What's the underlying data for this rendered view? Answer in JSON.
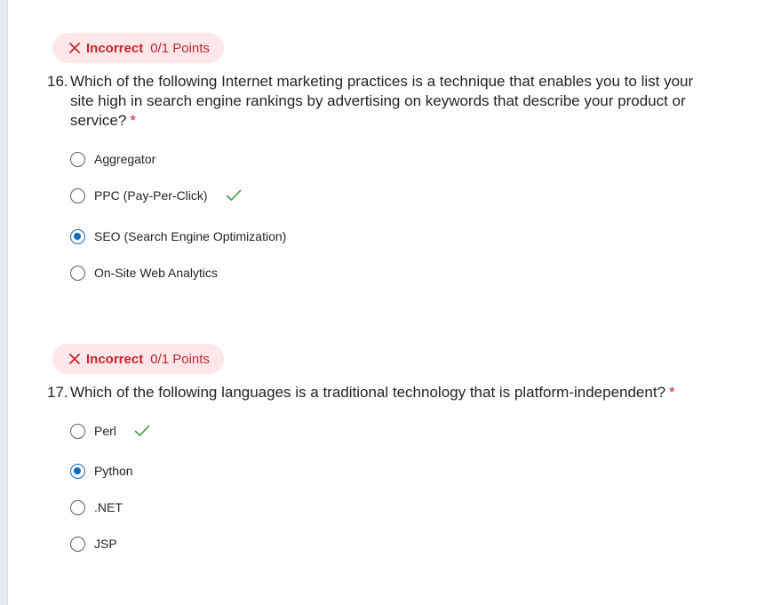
{
  "questions": [
    {
      "badge": {
        "status": "Incorrect",
        "points": "0/1 Points"
      },
      "number": "16.",
      "text": "Which of the following Internet marketing practices is a technique that enables you to list your site high in search engine rankings by advertising on keywords that describe your product or service?",
      "required_mark": "*",
      "options": [
        {
          "label": "Aggregator",
          "selected": false,
          "correct": false
        },
        {
          "label": "PPC (Pay-Per-Click)",
          "selected": false,
          "correct": true
        },
        {
          "label": "SEO (Search Engine Optimization)",
          "selected": true,
          "correct": false
        },
        {
          "label": "On-Site Web Analytics",
          "selected": false,
          "correct": false
        }
      ]
    },
    {
      "badge": {
        "status": "Incorrect",
        "points": "0/1 Points"
      },
      "number": "17.",
      "text": "Which of the following languages is a traditional technology that is platform-independent?",
      "required_mark": "*",
      "options": [
        {
          "label": "Perl",
          "selected": false,
          "correct": true
        },
        {
          "label": "Python",
          "selected": true,
          "correct": false
        },
        {
          "label": ".NET",
          "selected": false,
          "correct": false
        },
        {
          "label": "JSP",
          "selected": false,
          "correct": false
        }
      ]
    }
  ],
  "icons": {
    "incorrect": "close-icon",
    "correct": "checkmark-icon"
  },
  "colors": {
    "incorrect": "#c4262e",
    "badge_bg": "#fde7e9",
    "selected_radio": "#0f6cbd",
    "correct_check": "#3a9a3a"
  }
}
